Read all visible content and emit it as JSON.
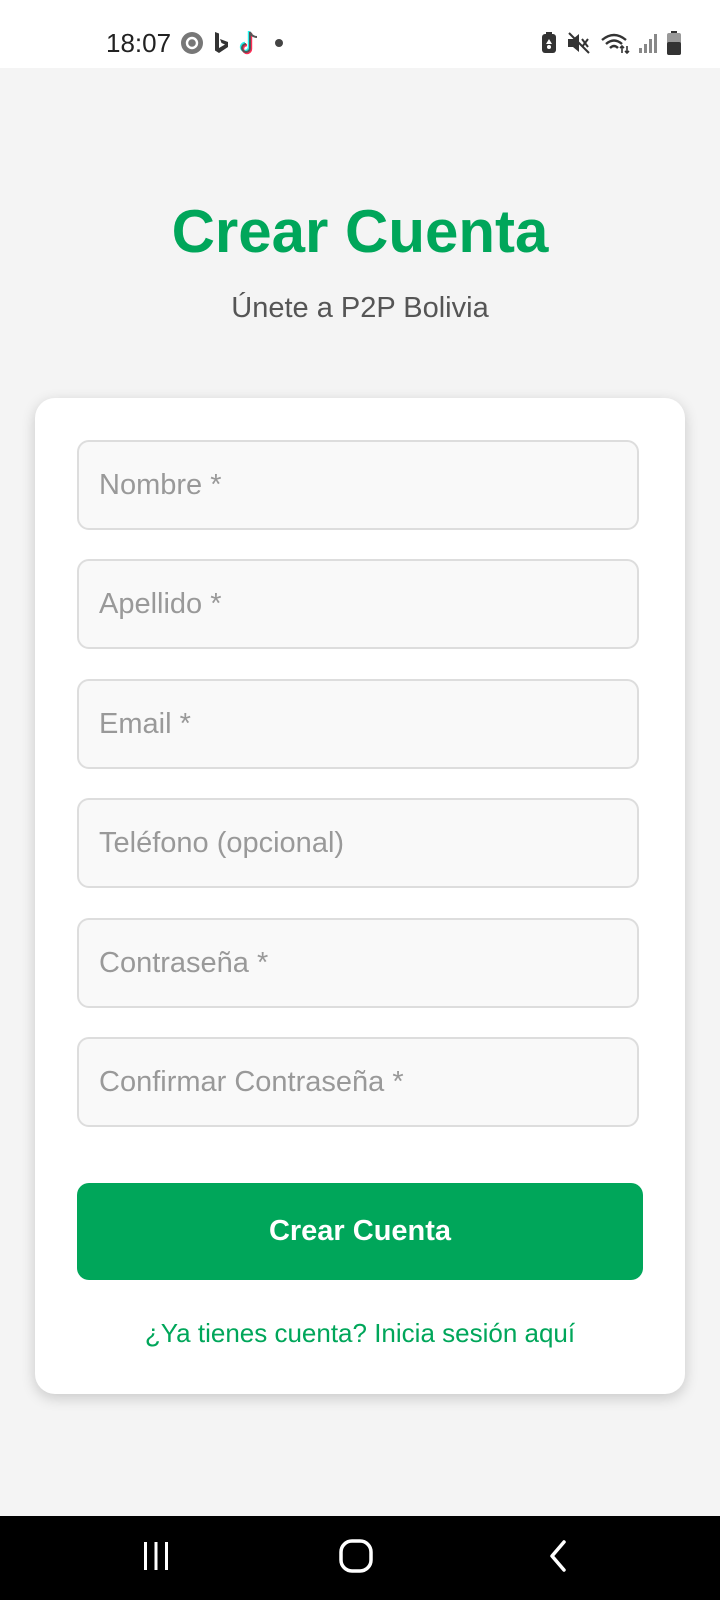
{
  "status_bar": {
    "time": "18:07",
    "left_icons": [
      "threads-icon",
      "bing-icon",
      "tiktok-icon",
      "notification-dot-icon"
    ],
    "right_icons": [
      "battery-saver-icon",
      "mute-icon",
      "wifi-icon",
      "signal-icon",
      "battery-icon"
    ]
  },
  "header": {
    "title": "Crear Cuenta",
    "subtitle": "Únete a P2P Bolivia"
  },
  "form": {
    "fields": [
      {
        "name": "nombre",
        "placeholder": "Nombre *",
        "value": ""
      },
      {
        "name": "apellido",
        "placeholder": "Apellido *",
        "value": ""
      },
      {
        "name": "email",
        "placeholder": "Email *",
        "value": ""
      },
      {
        "name": "telefono",
        "placeholder": "Teléfono (opcional)",
        "value": ""
      },
      {
        "name": "contrasena",
        "placeholder": "Contraseña *",
        "value": ""
      },
      {
        "name": "confirmar",
        "placeholder": "Confirmar Contraseña *",
        "value": ""
      }
    ],
    "submit_label": "Crear Cuenta",
    "login_link": "¿Ya tienes cuenta? Inicia sesión aquí"
  },
  "colors": {
    "accent": "#00a65a",
    "background": "#f4f4f4",
    "card": "#ffffff"
  },
  "nav_bar": {
    "buttons": [
      "recents-icon",
      "home-icon",
      "back-icon"
    ]
  }
}
